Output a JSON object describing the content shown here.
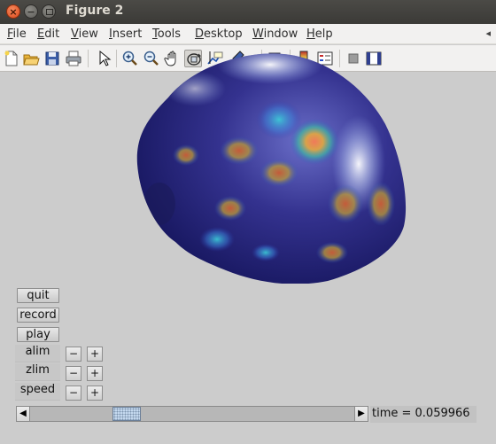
{
  "window": {
    "title": "Figure 2"
  },
  "menu": {
    "items": [
      {
        "key": "F",
        "rest": "ile"
      },
      {
        "key": "E",
        "rest": "dit"
      },
      {
        "key": "V",
        "rest": "iew"
      },
      {
        "key": "I",
        "rest": "nsert"
      },
      {
        "key": "T",
        "rest": "ools"
      },
      {
        "key": "D",
        "rest": "esktop"
      },
      {
        "key": "W",
        "rest": "indow"
      },
      {
        "key": "H",
        "rest": "elp"
      }
    ],
    "overflow_icon": "menu-arrow-icon"
  },
  "toolbar": {
    "icons": [
      "new-figure-icon",
      "open-file-icon",
      "save-icon",
      "print-icon",
      "select-arrow-icon",
      "zoom-in-icon",
      "zoom-out-icon",
      "pan-hand-icon",
      "rotate-3d-icon",
      "data-cursor-icon",
      "brush-icon",
      "link-plot-icon",
      "colorbar-icon",
      "legend-icon",
      "hide-plot-tools-icon",
      "show-plot-tools-icon"
    ],
    "active": "rotate-3d-icon"
  },
  "controls": {
    "quit": "quit",
    "record": "record",
    "play": "play",
    "alim": "alim",
    "zlim": "zlim",
    "speed": "speed",
    "minus": "−",
    "plus": "+"
  },
  "slider": {
    "left_arrow": "◀",
    "right_arrow": "▶",
    "value_fraction": 0.28
  },
  "status": {
    "time_text": "time = 0.059966"
  },
  "colors": {
    "background": "#cccccc",
    "brain_base": "#2d2c8a",
    "hotspot": "#e0603a"
  }
}
